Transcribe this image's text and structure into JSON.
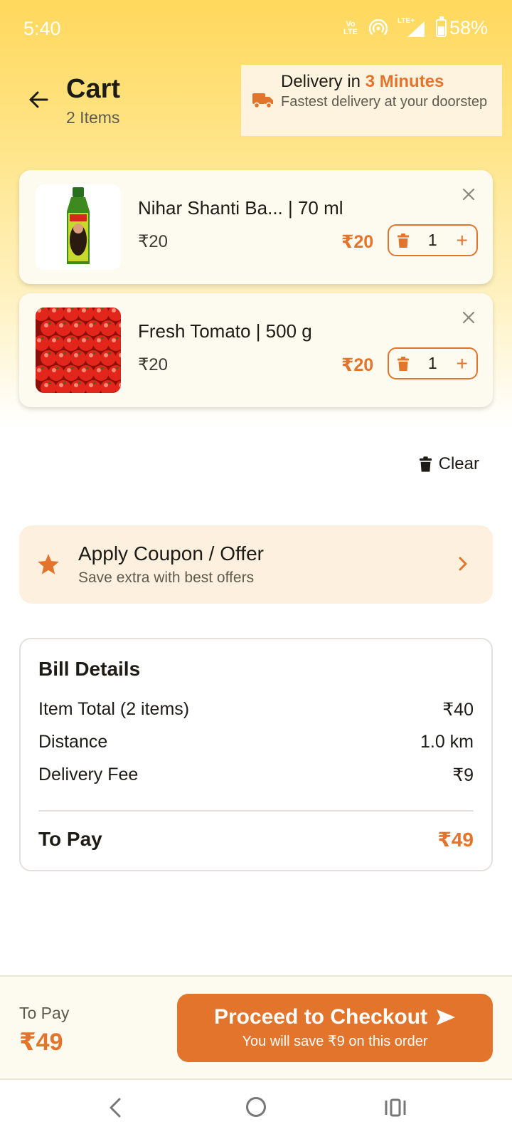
{
  "status_bar": {
    "time": "5:40",
    "volte_line1": "Vo",
    "volte_line2": "LTE",
    "lte": "LTE+",
    "battery_level": 0.58,
    "battery_pct": "58%"
  },
  "header": {
    "title": "Cart",
    "subtitle": "2 Items"
  },
  "delivery": {
    "prefix": "Delivery in ",
    "highlight": "3 Minutes",
    "subtitle": "Fastest delivery at your doorstep"
  },
  "items": [
    {
      "name": "Nihar Shanti Ba... | 70 ml",
      "mrp": "₹20",
      "price": "₹20",
      "qty": "1",
      "plus": "+",
      "image": "hair-oil-bottle"
    },
    {
      "name": "Fresh Tomato | 500 g",
      "mrp": "₹20",
      "price": "₹20",
      "qty": "1",
      "plus": "+",
      "image": "tomatoes"
    }
  ],
  "clear_label": "Clear",
  "coupon": {
    "title": "Apply Coupon / Offer",
    "subtitle": "Save extra with best offers"
  },
  "bill": {
    "title": "Bill Details",
    "rows": [
      {
        "label": "Item Total (2 items)",
        "value": "₹40"
      },
      {
        "label": "Distance",
        "value": "1.0 km"
      },
      {
        "label": "Delivery Fee",
        "value": "₹9"
      }
    ],
    "total_label": "To Pay",
    "total_value": "₹49"
  },
  "bottom_bar": {
    "to_pay_label": "To Pay",
    "to_pay_amount": "₹49",
    "checkout_label": "Proceed to Checkout",
    "checkout_sub": "You will save ₹9 on this order"
  },
  "colors": {
    "accent": "#e2742c",
    "header_yellow": "#ffd85c",
    "card_bg": "#fdfbef",
    "coupon_bg": "#fdf0de"
  },
  "icons": [
    "back-arrow-icon",
    "truck-icon",
    "close-icon",
    "trash-icon",
    "star-icon",
    "chevron-right-icon",
    "send-icon"
  ]
}
